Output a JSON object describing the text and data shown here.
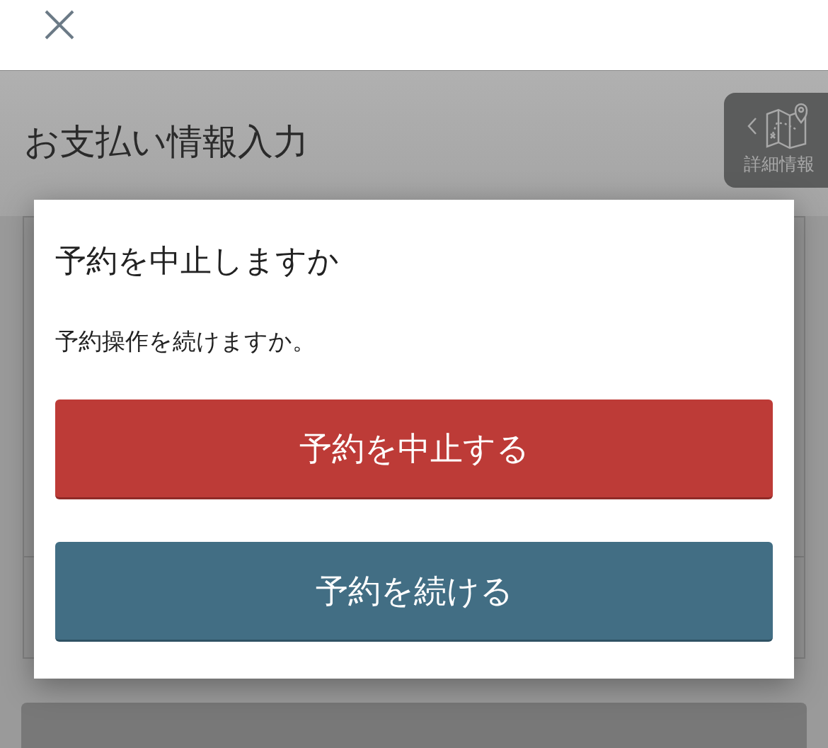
{
  "page": {
    "title": "お支払い情報入力"
  },
  "details_tab": {
    "label": "詳細情報"
  },
  "dialog": {
    "title": "予約を中止しますか",
    "message": "予約操作を続けますか。",
    "buttons": [
      {
        "label": "予約を中止する",
        "kind": "danger"
      },
      {
        "label": "予約を続ける",
        "kind": "primary"
      }
    ]
  }
}
